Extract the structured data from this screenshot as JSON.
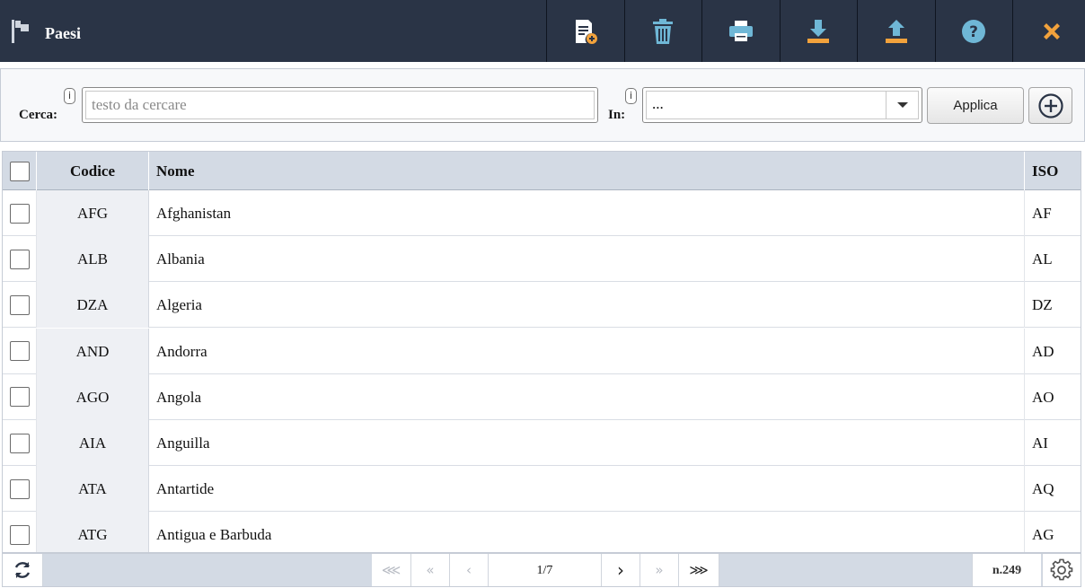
{
  "header": {
    "title": "Paesi",
    "logo_icon": "flag-icon",
    "toolbar": [
      {
        "name": "new-document-button",
        "icon": "document-add-icon",
        "color": "#ffffff"
      },
      {
        "name": "delete-button",
        "icon": "trash-icon",
        "color": "#6fb7d6"
      },
      {
        "name": "print-button",
        "icon": "printer-icon",
        "color": "#6fb7d6"
      },
      {
        "name": "download-button",
        "icon": "download-icon",
        "color": "#6fb7d6"
      },
      {
        "name": "upload-button",
        "icon": "upload-icon",
        "color": "#6fb7d6"
      },
      {
        "name": "help-button",
        "icon": "help-icon",
        "color": "#6fb7d6"
      },
      {
        "name": "close-button",
        "icon": "close-icon",
        "color": "#f2a23c"
      }
    ]
  },
  "search": {
    "label": "Cerca:",
    "info": "i",
    "placeholder": "testo da cercare",
    "value": "",
    "in_label": "In:",
    "in_info": "i",
    "in_value": "...",
    "apply_label": "Applica"
  },
  "table": {
    "columns": {
      "code": "Codice",
      "name": "Nome",
      "iso": "ISO"
    },
    "rows": [
      {
        "code": "AFG",
        "name": "Afghanistan",
        "iso": "AF"
      },
      {
        "code": "ALB",
        "name": "Albania",
        "iso": "AL"
      },
      {
        "code": "DZA",
        "name": "Algeria",
        "iso": "DZ"
      },
      {
        "code": "AND",
        "name": "Andorra",
        "iso": "AD"
      },
      {
        "code": "AGO",
        "name": "Angola",
        "iso": "AO"
      },
      {
        "code": "AIA",
        "name": "Anguilla",
        "iso": "AI"
      },
      {
        "code": "ATA",
        "name": "Antartide",
        "iso": "AQ"
      },
      {
        "code": "ATG",
        "name": "Antigua e Barbuda",
        "iso": "AG"
      }
    ]
  },
  "pager": {
    "first": "⋘",
    "prev_page_group": "«",
    "prev": "‹",
    "page": "1/7",
    "next": "›",
    "next_page_group": "»",
    "last": "⋙",
    "count": "n.249"
  }
}
